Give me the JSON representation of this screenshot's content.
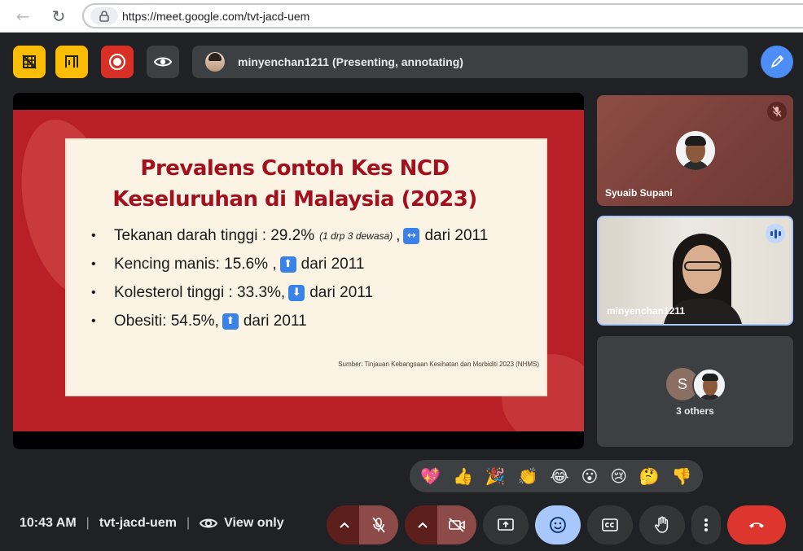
{
  "browser": {
    "url": "https://meet.google.com/tvt-jacd-uem",
    "back_icon": "←",
    "reload_icon": "↻"
  },
  "toolbar": {
    "presenter_text": "minyenchan1211 (Presenting, annotating)"
  },
  "slide": {
    "title_line1": "Prevalens Contoh Kes NCD",
    "title_line2": "Keseluruhan di Malaysia (2023)",
    "bullets": [
      {
        "text": "Tekanan darah tinggi : 29.2%",
        "note": "(1 drp 3 dewasa)",
        "sep": ",",
        "arrow": "↔",
        "trend": "dari 2011"
      },
      {
        "text": "Kencing manis: 15.6% ,",
        "arrow": "⬆",
        "trend": "dari 2011"
      },
      {
        "text": "Kolesterol tinggi : 33.3%,",
        "arrow": "⬇",
        "trend": "dari 2011"
      },
      {
        "text": "Obesiti: 54.5%,",
        "arrow": "⬆",
        "trend": "dari 2011"
      }
    ],
    "bullet_char": "•",
    "source": "Sumber: Tinjauan Kebangsaan Kesihatan dan Morbiditi 2023 (NHMS)"
  },
  "participants": {
    "tile1_name": "Syuaib Supani",
    "tile2_name": "minyenchan1211",
    "others_initial": "S",
    "others_label": "3 others"
  },
  "reactions": [
    "💖",
    "👍",
    "🎉",
    "👏",
    "😂",
    "😮",
    "😢",
    "🤔",
    "👎"
  ],
  "meeting": {
    "time": "10:43 AM",
    "sep": "|",
    "code": "tvt-jacd-uem",
    "view_mode": "View only"
  },
  "colors": {
    "accent_blue": "#4c8df6",
    "slide_red": "#b81f26",
    "title_red": "#a3101d",
    "end_call": "#dc362e"
  }
}
